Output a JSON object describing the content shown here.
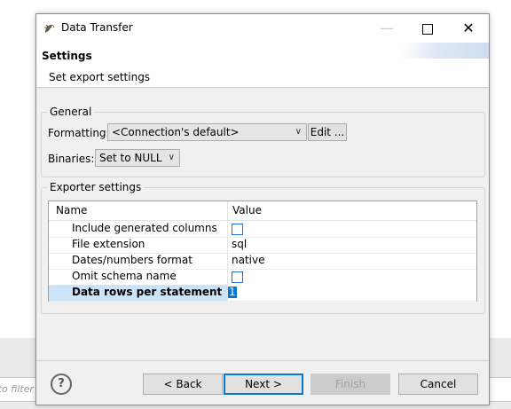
{
  "background": {
    "filter_placeholder": "to filter"
  },
  "dialog": {
    "title": "Data Transfer",
    "window_buttons": {
      "minimize": "—",
      "close": "✕"
    },
    "header": {
      "title": "Settings",
      "description": "Set export settings"
    },
    "general": {
      "label": "General",
      "formatting_label": "Formatting:",
      "formatting_value": "<Connection's default>",
      "edit_button": "Edit ...",
      "binaries_label": "Binaries:",
      "binaries_value": "Set to NULL"
    },
    "exporter": {
      "label": "Exporter settings",
      "columns": [
        "Name",
        "Value"
      ],
      "rows": [
        {
          "name": "Include generated columns",
          "value": "",
          "type": "checkbox",
          "checked": false
        },
        {
          "name": "File extension",
          "value": "sql",
          "type": "text"
        },
        {
          "name": "Dates/numbers format",
          "value": "native",
          "type": "text"
        },
        {
          "name": "Omit schema name",
          "value": "",
          "type": "checkbox",
          "checked": false
        },
        {
          "name": "Data rows per statement",
          "value": "1",
          "type": "edit",
          "selected": true
        }
      ]
    },
    "buttons": {
      "help": "?",
      "back": "< Back",
      "next": "Next >",
      "finish": "Finish",
      "cancel": "Cancel"
    }
  },
  "colors": {
    "accent": "#0078d7",
    "selection": "#cce4f7",
    "checkbox_border": "#1a73d9"
  }
}
